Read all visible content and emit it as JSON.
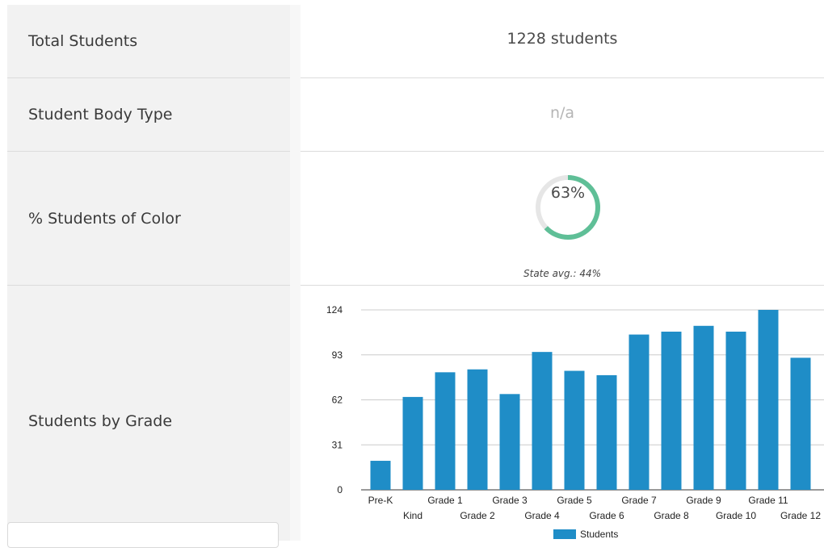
{
  "rows": [
    {
      "label": "Total Students",
      "value": "1228 students"
    },
    {
      "label": "Student Body Type",
      "value": "n/a"
    },
    {
      "label": "% Students of Color",
      "value": "63%",
      "state_avg": "State avg.: 44%"
    },
    {
      "label": "Students by Grade"
    }
  ],
  "colors": {
    "donut_fill": "#5fbf97",
    "donut_track": "#e6e6e6",
    "bar": "#1f8dc7"
  },
  "donut_fraction": 0.63,
  "chart_data": {
    "type": "bar",
    "categories": [
      "Pre-K",
      "Kind",
      "Grade 1",
      "Grade 2",
      "Grade 3",
      "Grade 4",
      "Grade 5",
      "Grade 6",
      "Grade 7",
      "Grade 8",
      "Grade 9",
      "Grade 10",
      "Grade 11",
      "Grade 12"
    ],
    "series": [
      {
        "name": "Students",
        "values": [
          20,
          64,
          81,
          83,
          66,
          95,
          82,
          79,
          107,
          109,
          113,
          109,
          124,
          91
        ]
      }
    ],
    "yticks": [
      "0",
      "31",
      "62",
      "93",
      "124"
    ],
    "ylim": [
      0,
      124
    ],
    "grid": true,
    "legend": "bottom"
  }
}
